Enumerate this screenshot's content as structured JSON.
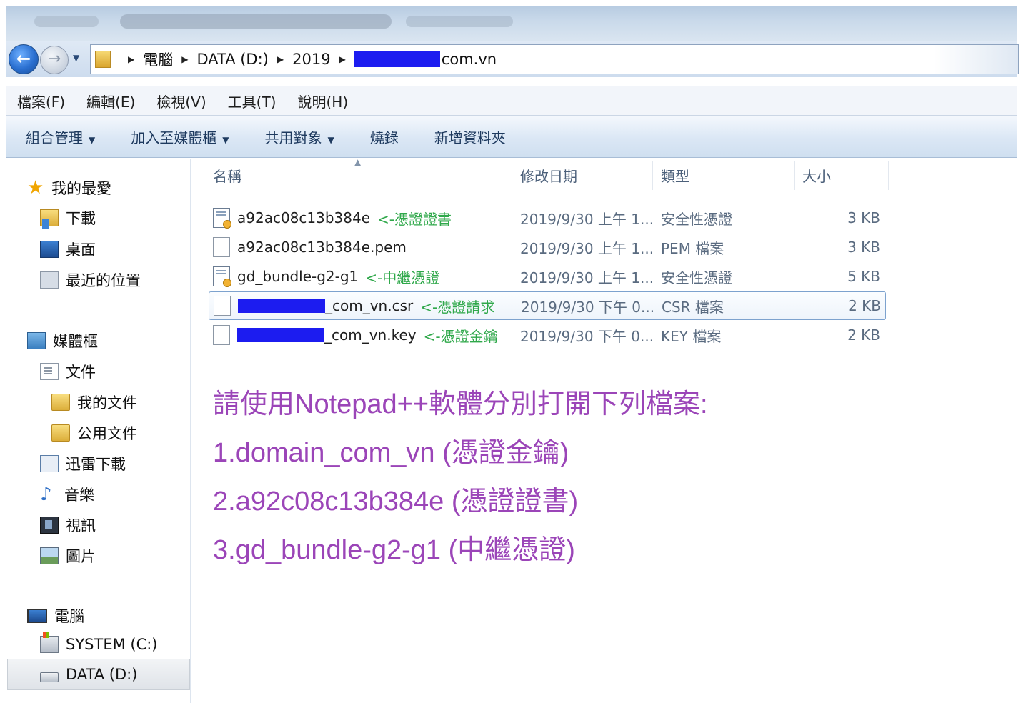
{
  "address_bar": {
    "crumbs": [
      "電腦",
      "DATA (D:)",
      "2019"
    ],
    "last_crumb_suffix": "com.vn"
  },
  "menu": [
    "檔案(F)",
    "編輯(E)",
    "檢視(V)",
    "工具(T)",
    "說明(H)"
  ],
  "toolbar": {
    "organize": "組合管理",
    "add_to_library": "加入至媒體櫃",
    "share_with": "共用對象",
    "burn": "燒錄",
    "new_folder": "新增資料夾"
  },
  "navpane": {
    "favorites": {
      "label": "我的最愛",
      "items": [
        "下載",
        "桌面",
        "最近的位置"
      ]
    },
    "libraries": {
      "label": "媒體櫃",
      "documents": "文件",
      "my_documents": "我的文件",
      "public_documents": "公用文件",
      "items": [
        "迅雷下載",
        "音樂",
        "視訊",
        "圖片"
      ]
    },
    "computer": {
      "label": "電腦",
      "drives": [
        "SYSTEM (C:)",
        "DATA (D:)"
      ]
    }
  },
  "columns": {
    "name": "名稱",
    "date": "修改日期",
    "type": "類型",
    "size": "大小"
  },
  "files": [
    {
      "name": "a92ac08c13b384e",
      "note": "<-憑證證書",
      "date": "2019/9/30 上午 1...",
      "type": "安全性憑證",
      "size": "3 KB"
    },
    {
      "name": "a92ac08c13b384e.pem",
      "note": "",
      "date": "2019/9/30 上午 1...",
      "type": "PEM 檔案",
      "size": "3 KB"
    },
    {
      "name": "gd_bundle-g2-g1",
      "note": "<-中繼憑證",
      "date": "2019/9/30 上午 1...",
      "type": "安全性憑證",
      "size": "5 KB"
    },
    {
      "name": "_com_vn.csr",
      "note": "<-憑證請求",
      "date": "2019/9/30 下午 0...",
      "type": "CSR 檔案",
      "size": "2 KB"
    },
    {
      "name": "_com_vn.key",
      "note": "<-憑證金鑰",
      "date": "2019/9/30 下午 0...",
      "type": "KEY 檔案",
      "size": "2 KB"
    }
  ],
  "instructions": [
    "請使用Notepad++軟體分別打開下列檔案:",
    "1.domain_com_vn (憑證金鑰)",
    "2.a92c08c13b384e (憑證證書)",
    "3.gd_bundle-g2-g1 (中繼憑證)"
  ],
  "colors": {
    "note_green": "#2fa84a",
    "instruction_purple": "#9b45b8",
    "redaction_blue": "#1c1cf0"
  }
}
